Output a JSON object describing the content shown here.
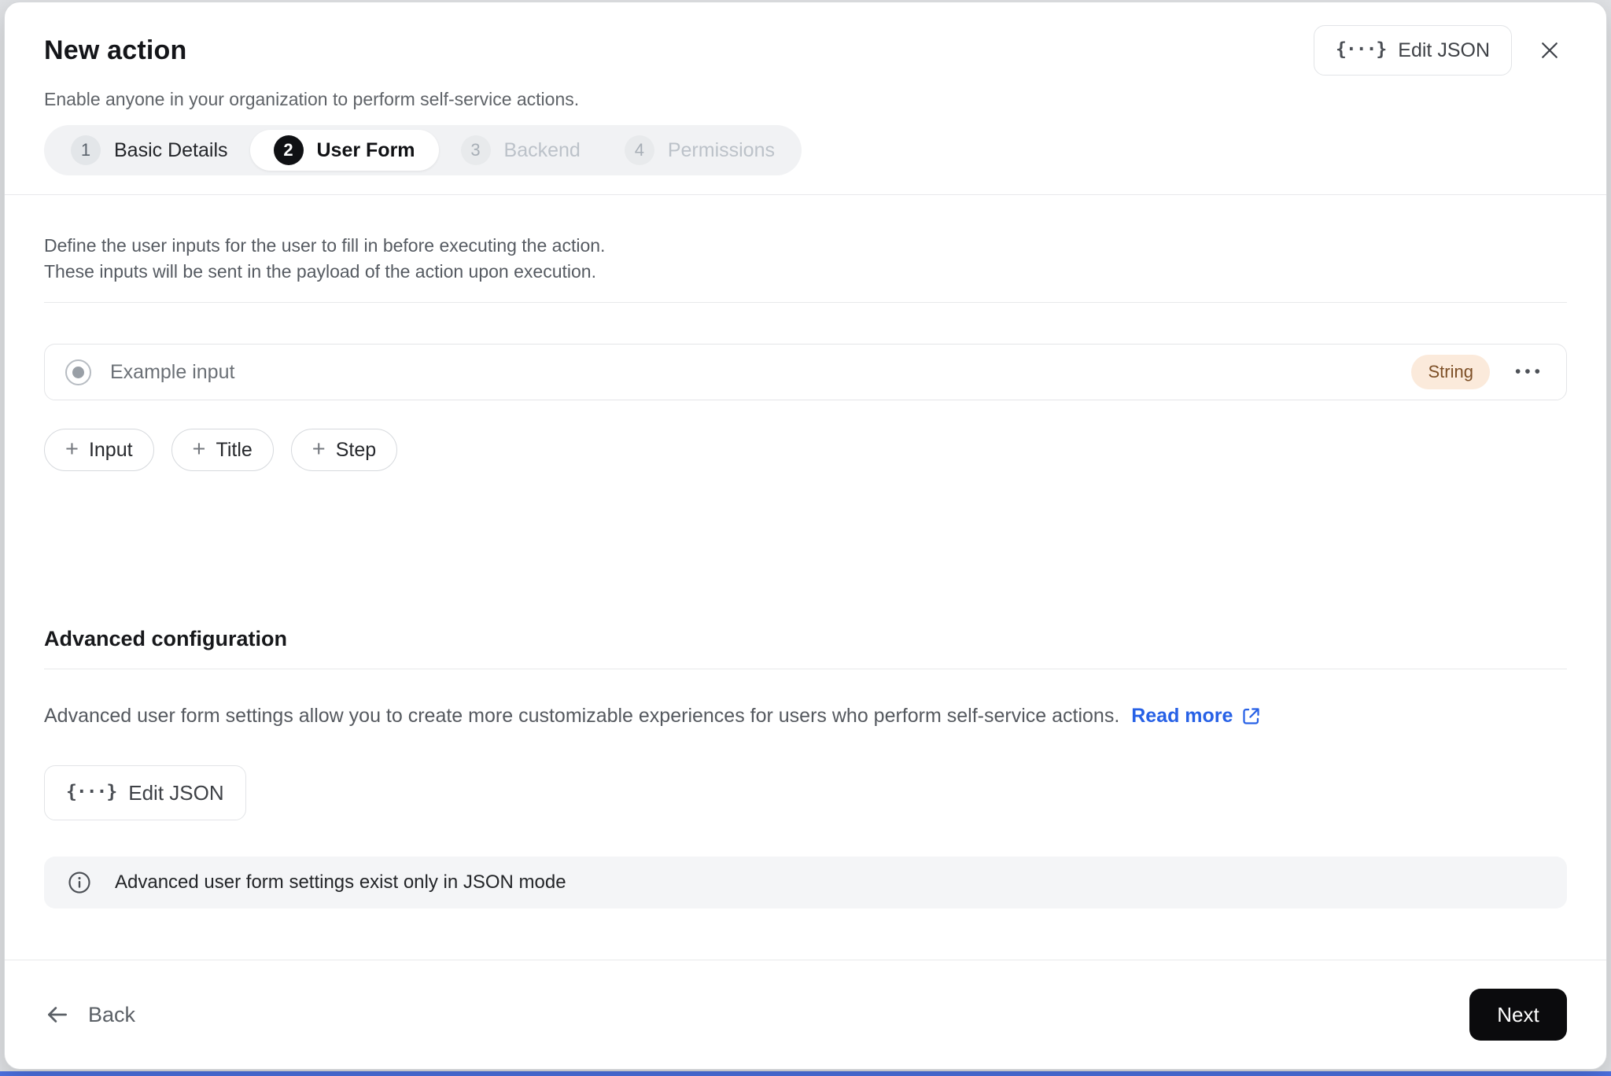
{
  "header": {
    "title": "New action",
    "subtitle": "Enable anyone in your organization to perform self-service actions.",
    "edit_json_button": "Edit JSON"
  },
  "icons": {
    "json_braces": "{···}",
    "plus": "+",
    "ellipsis": "•••"
  },
  "stepper": {
    "steps": [
      {
        "number": "1",
        "label": "Basic Details",
        "state": "done"
      },
      {
        "number": "2",
        "label": "User Form",
        "state": "active"
      },
      {
        "number": "3",
        "label": "Backend",
        "state": "upcoming"
      },
      {
        "number": "4",
        "label": "Permissions",
        "state": "upcoming"
      }
    ]
  },
  "form": {
    "description_line1": "Define the user inputs for the user to fill in before executing the action.",
    "description_line2": "These inputs will be sent in the payload of the action upon execution.",
    "input_row": {
      "label": "Example input",
      "type_badge": "String"
    },
    "add_buttons": {
      "input": "Input",
      "title": "Title",
      "step": "Step"
    }
  },
  "advanced": {
    "heading": "Advanced configuration",
    "description": "Advanced user form settings allow you to create more customizable experiences for users who perform self-service actions.",
    "read_more": "Read more",
    "edit_json_button": "Edit JSON",
    "info_text": "Advanced user form settings exist only in JSON mode"
  },
  "footer": {
    "back": "Back",
    "next": "Next"
  },
  "colors": {
    "accent_link": "#2761e6",
    "badge_bg": "#fbeadb",
    "badge_text": "#7d4f26",
    "primary_button_bg": "#0b0b0d",
    "stepper_bg": "#f1f2f4"
  }
}
